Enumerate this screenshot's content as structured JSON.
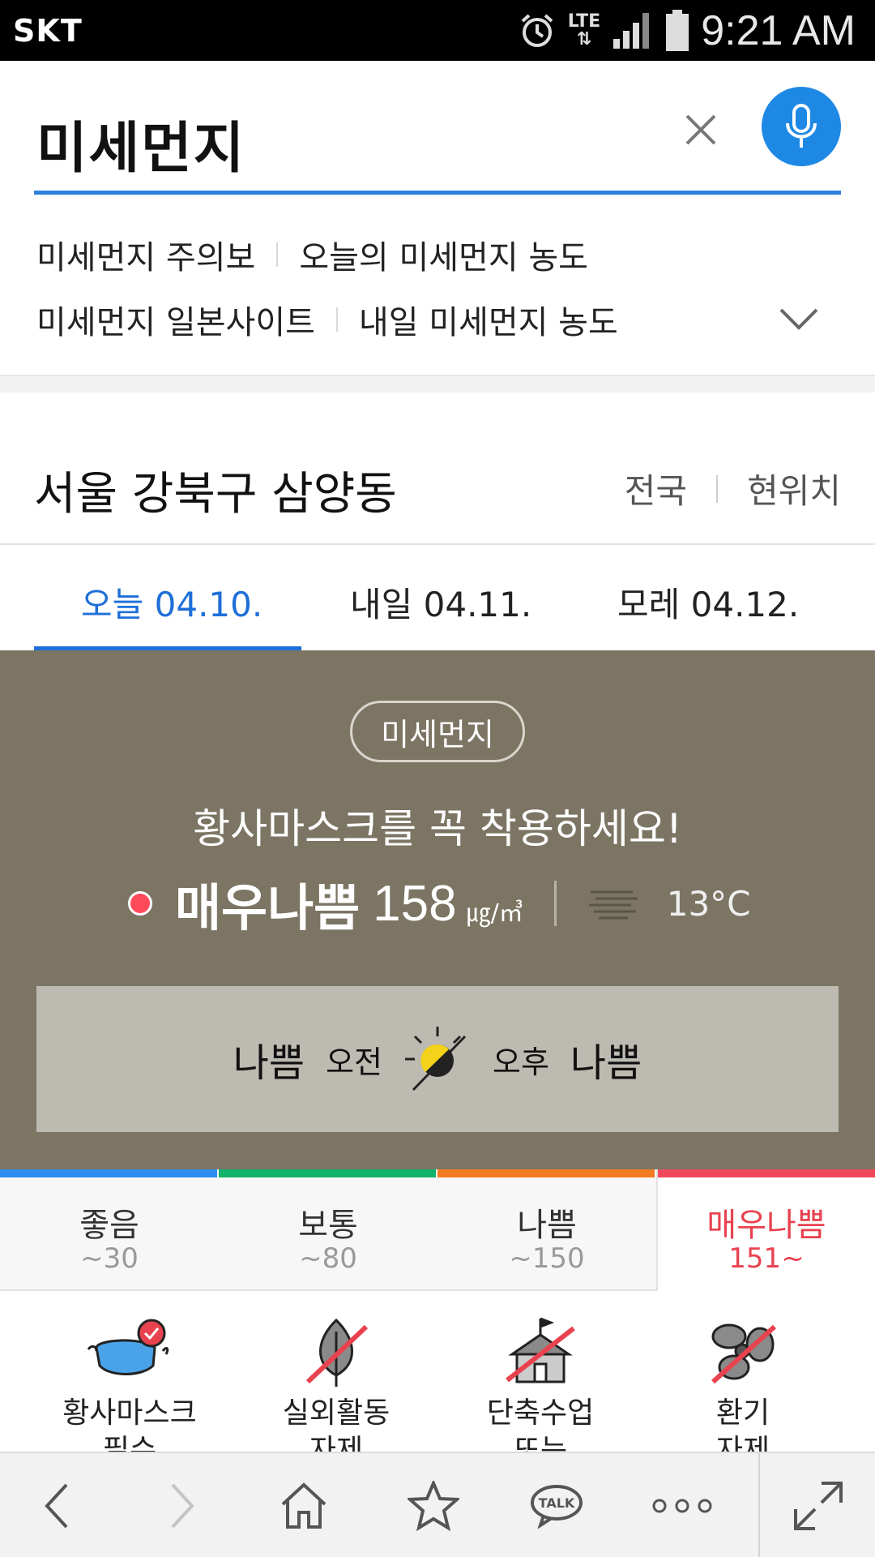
{
  "status_bar": {
    "carrier": "SKT",
    "network": "LTE",
    "time": "9:21 AM"
  },
  "search": {
    "query": "미세먼지"
  },
  "suggestions": [
    [
      "미세먼지 주의보",
      "오늘의 미세먼지 농도"
    ],
    [
      "미세먼지 일본사이트",
      "내일 미세먼지 농도"
    ]
  ],
  "location": {
    "name": "서울 강북구 삼양동",
    "link_national": "전국",
    "link_current": "현위치"
  },
  "date_tabs": [
    {
      "label": "오늘 04.10.",
      "active": true
    },
    {
      "label": "내일 04.11.",
      "active": false
    },
    {
      "label": "모레 04.12.",
      "active": false
    }
  ],
  "dust": {
    "pill": "미세먼지",
    "advice": "황사마스크를 꼭 착용하세요!",
    "grade": "매우나쁨",
    "value": "158",
    "unit": "㎍/㎥",
    "temperature": "13°C",
    "dot_color": "#ff4a5a",
    "am_grade": "나쁨",
    "am_label": "오전",
    "pm_label": "오후",
    "pm_grade": "나쁨"
  },
  "scale": [
    {
      "name": "좋음",
      "range": "~30",
      "color": "#2d8cf0"
    },
    {
      "name": "보통",
      "range": "~80",
      "color": "#11b36b"
    },
    {
      "name": "나쁨",
      "range": "~150",
      "color": "#f47c20"
    },
    {
      "name": "매우나쁨",
      "range": "151~",
      "color": "#f0485a"
    }
  ],
  "actions": [
    {
      "icon": "mask-icon",
      "line1": "황사마스크",
      "line2": "필수"
    },
    {
      "icon": "leaf-crossed-icon",
      "line1": "실외활동",
      "line2": "자제"
    },
    {
      "icon": "school-crossed-icon",
      "line1": "단축수업",
      "line2": "또는"
    },
    {
      "icon": "fan-crossed-icon",
      "line1": "환기",
      "line2": "자제"
    }
  ],
  "colors": {
    "accent": "#1e6fd9",
    "panel": "#7c7564",
    "mic": "#1e88e5"
  }
}
